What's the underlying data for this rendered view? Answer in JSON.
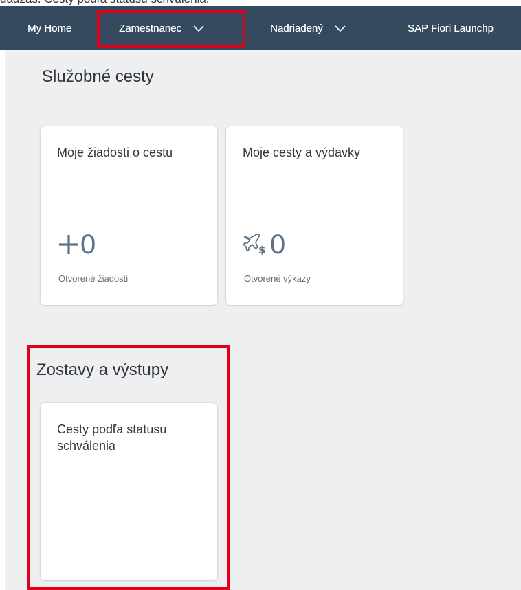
{
  "clipped_caption": "dadzaš. Cesty podľa statusu schválenia.",
  "shell": {
    "nav": [
      {
        "label": "My Home"
      },
      {
        "label": "Zamestnanec"
      },
      {
        "label": "Nadriadený"
      },
      {
        "label": "SAP Fiori Launchp"
      }
    ]
  },
  "sections": [
    {
      "title": "Služobné cesty",
      "tiles": [
        {
          "title": "Moje žiadosti o cestu",
          "kpi": "0",
          "kpi_icon": "plus-icon",
          "footer": "Otvorené žiadosti"
        },
        {
          "title": "Moje cesty a výdavky",
          "kpi": "0",
          "kpi_icon": "travel-expense-icon",
          "footer": "Otvorené výkazy"
        }
      ]
    },
    {
      "title": "Zostavy a výstupy",
      "tiles": [
        {
          "title": "Cesty podľa statusu schválenia"
        }
      ]
    }
  ],
  "colors": {
    "shellbar": "#354a5f",
    "highlight": "#e0001b",
    "page_background": "#edeff0",
    "kpi": "#5c7287"
  }
}
